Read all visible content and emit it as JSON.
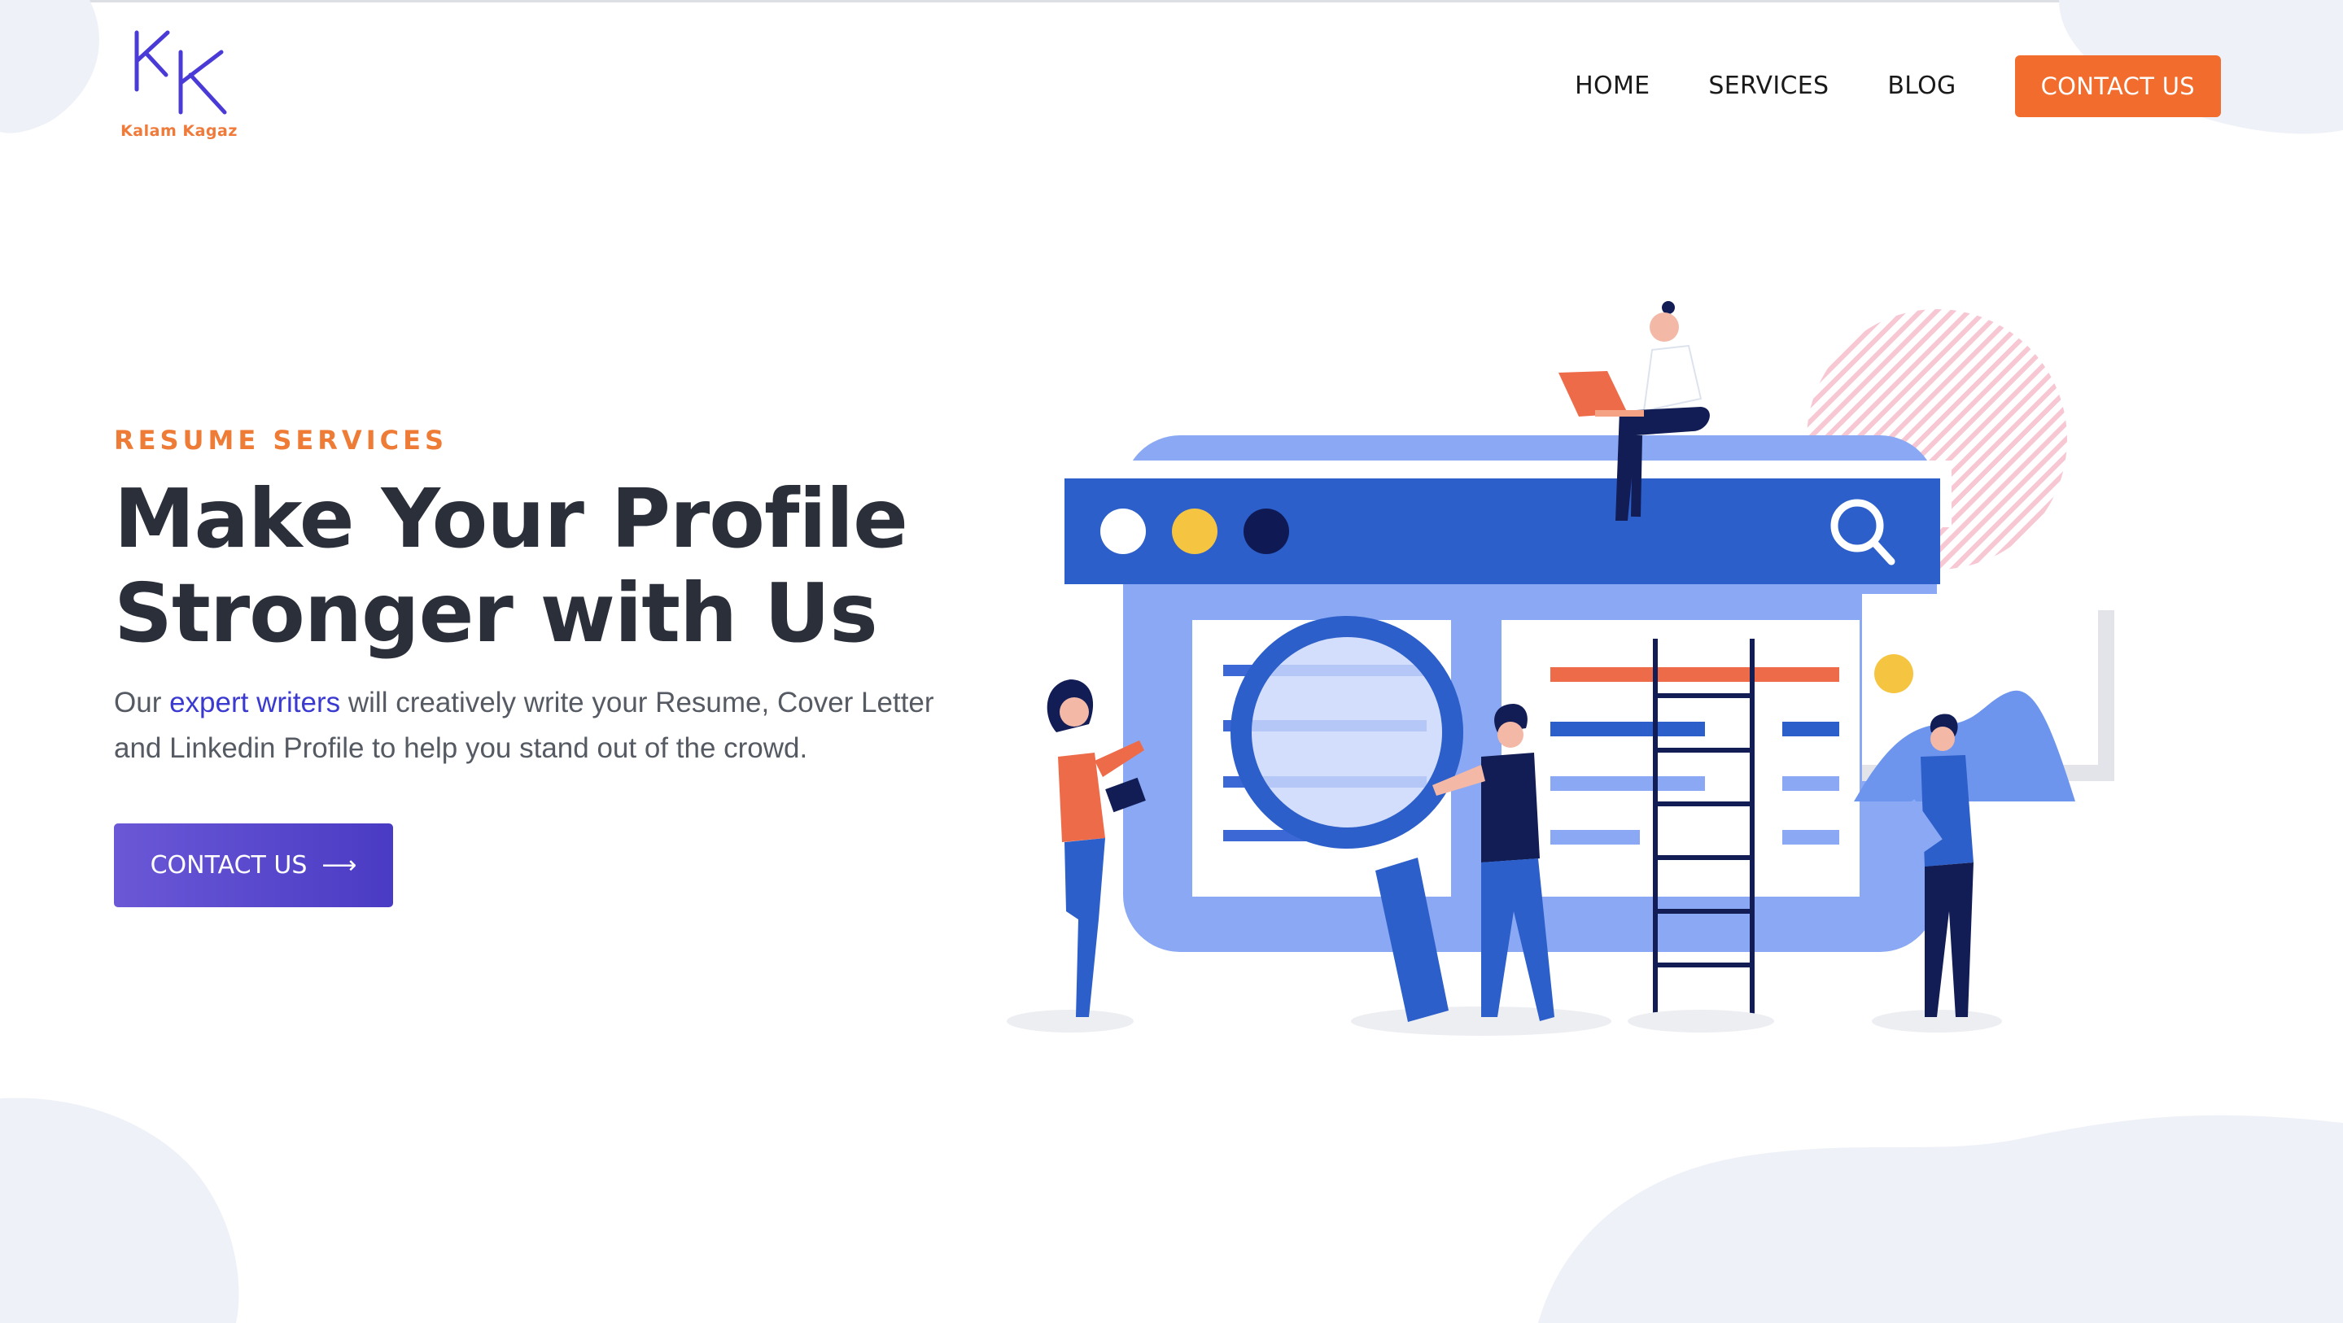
{
  "brand": {
    "name": "Kalam Kagaz",
    "logo_color": "#4b3bd6",
    "accent": "#f26c2d"
  },
  "nav": {
    "items": [
      {
        "label": "HOME"
      },
      {
        "label": "SERVICES"
      },
      {
        "label": "BLOG"
      }
    ],
    "cta_label": "CONTACT US"
  },
  "hero": {
    "eyebrow": "RESUME SERVICES",
    "title_line1": "Make Your Profile",
    "title_line2": "Stronger with Us",
    "text_pre": "Our ",
    "text_highlight": "expert writers",
    "text_post": " will creatively write your Resume, Cover Letter and Linkedin Profile to help you stand out of the crowd.",
    "cta_label": "CONTACT US",
    "cta_icon": "arrow-right-icon"
  },
  "illustration": {
    "icons": [
      "search-icon",
      "magnifier-icon",
      "ladder-icon",
      "laptop-icon"
    ]
  }
}
